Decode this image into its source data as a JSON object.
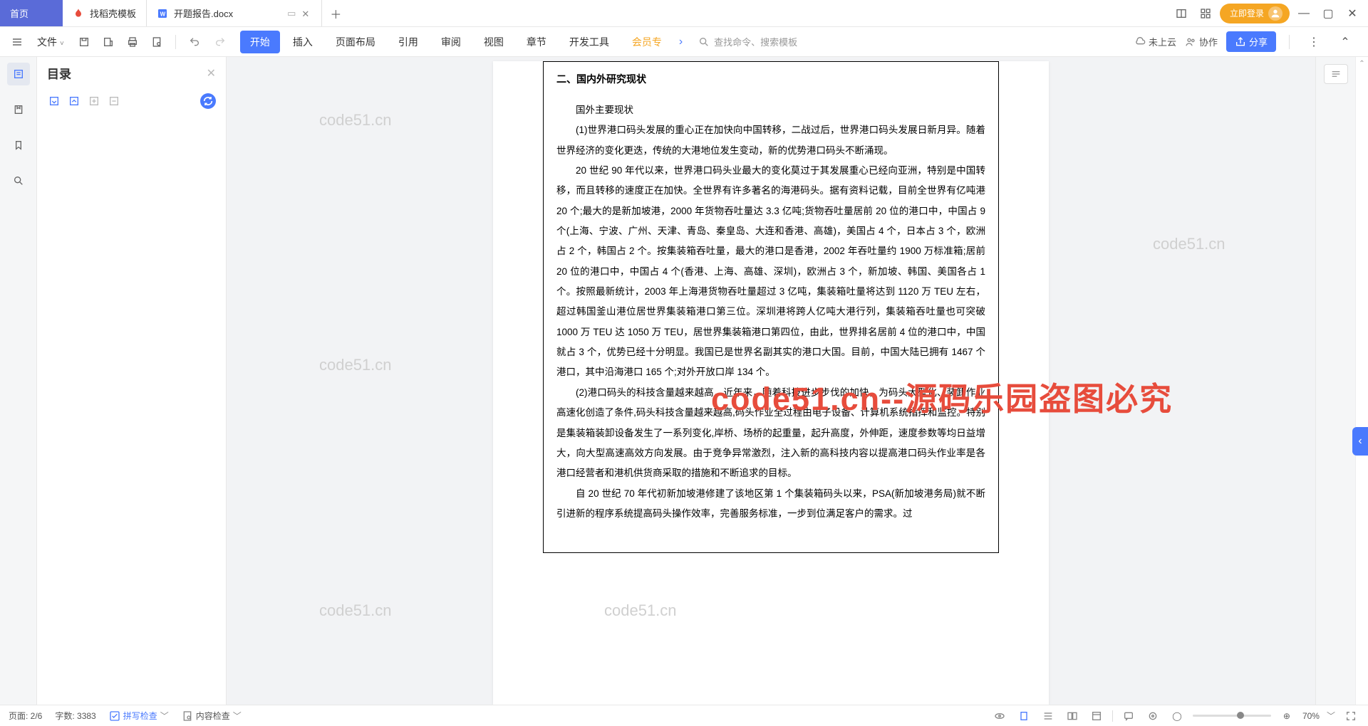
{
  "tabs": {
    "home": "首页",
    "t1": "找稻壳模板",
    "t2": "开题报告.docx"
  },
  "login": "立即登录",
  "file_menu": "文件",
  "menu": {
    "start": "开始",
    "insert": "插入",
    "layout": "页面布局",
    "ref": "引用",
    "review": "审阅",
    "view": "视图",
    "chapter": "章节",
    "dev": "开发工具",
    "vip": "会员专"
  },
  "search": {
    "ph1": "查找命令、搜索模板"
  },
  "right_menu": {
    "cloud": "未上云",
    "collab": "协作",
    "share": "分享"
  },
  "toc": {
    "title": "目录"
  },
  "doc": {
    "section": "二、国内外研究现状",
    "sub1": "国外主要现状",
    "p1": "(1)世界港口码头发展的重心正在加快向中国转移，二战过后，世界港口码头发展日新月异。随着世界经济的变化更迭，传统的大港地位发生变动，新的优势港口码头不断涌现。",
    "p2": "20 世纪 90 年代以来，世界港口码头业最大的变化莫过于其发展重心已经向亚洲，特别是中国转移，而且转移的速度正在加快。全世界有许多著名的海港码头。据有资料记载，目前全世界有亿吨港 20 个;最大的是新加坡港，2000 年货物吞吐量达 3.3 亿吨;货物吞吐量居前 20 位的港口中，中国占 9 个(上海、宁波、广州、天津、青岛、秦皇岛、大连和香港、高雄)，美国占 4 个，日本占 3 个，欧洲占 2 个，韩国占 2 个。按集装箱吞吐量，最大的港口是香港，2002 年吞吐量约 1900 万标准箱;居前 20 位的港口中，中国占 4 个(香港、上海、高雄、深圳)，欧洲占 3 个，新加坡、韩国、美国各占 1 个。按照最新统计，2003 年上海港货物吞吐量超过 3 亿吨，集装箱吐量将达到 1120 万 TEU 左右，超过韩国釜山港位居世界集装箱港口第三位。深圳港将跨人亿吨大港行列，集装箱吞吐量也可突破 1000 万 TEU 达 1050 万 TEU，居世界集装箱港口第四位，由此，世界排名居前 4 位的港口中，中国就占 3 个，优势已经十分明显。我国已是世界名副其实的港口大国。目前，中国大陆已拥有 1467 个港口，其中沿海港口 165 个;对外开放口岸 134 个。",
    "p3": "(2)港口码头的科技含量越来越高，近年来，随着科技进步步伐的加快，为码头大型化、装卸作业高速化创造了条件,码头科技含量越来越高,码头作业全过程由电子设备、计算机系统指挥和监控。特别是集装箱装卸设备发生了一系列变化,岸桥、场桥的起重量，起升高度，外伸距，速度参数等均日益增大，向大型高速高效方向发展。由于竞争异常激烈，注入新的高科技内容以提高港口码头作业率是各港口经营者和港机供货商采取的措施和不断追求的目标。",
    "p4": "自 20 世纪 70 年代初新加坡港修建了该地区第 1 个集装箱码头以来，PSA(新加坡港务局)就不断引进新的程序系统提高码头操作效率，完善服务标准，一步到位满足客户的需求。过"
  },
  "watermark": "code51.cn",
  "big_wm": "code51.cn--源码乐园盗图必究",
  "status": {
    "page": "页面: 2/6",
    "words": "字数: 3383",
    "spell": "拼写检查",
    "content": "内容检查",
    "zoom": "70%"
  }
}
